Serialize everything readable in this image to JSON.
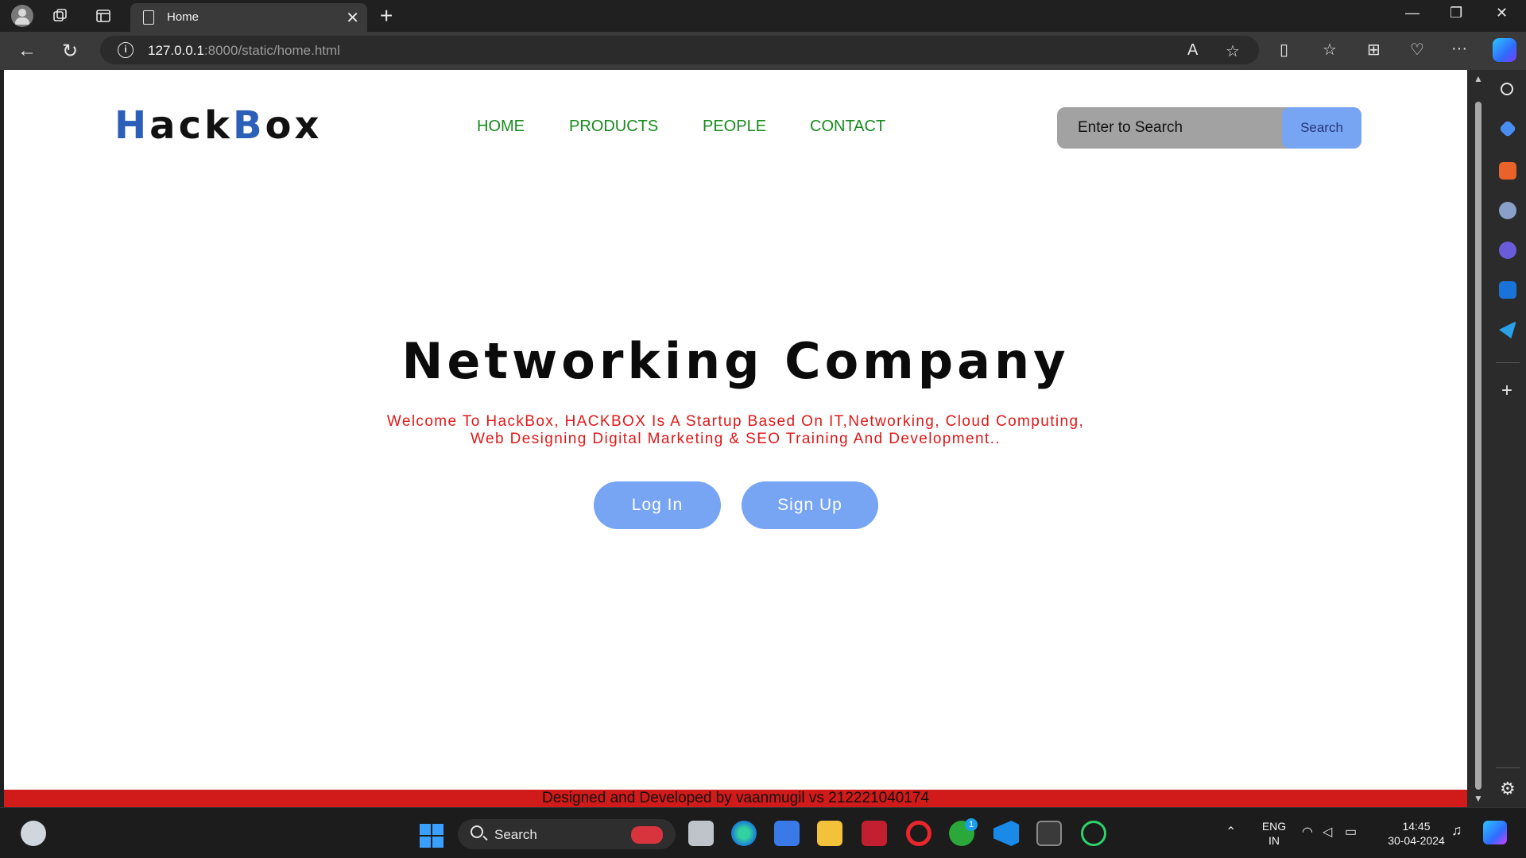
{
  "browser": {
    "tab_title": "Home",
    "tab_close_glyph": "✕",
    "new_tab_glyph": "+",
    "url_host": "127.0.0.1",
    "url_path": ":8000/static/home.html",
    "win_controls": {
      "minimize": "—",
      "restore": "❐",
      "close": "✕"
    },
    "icons": {
      "back": "←",
      "reload": "↻",
      "info": "i",
      "read_aloud": "A",
      "favorite": "☆",
      "split": "▯",
      "favorites": "☆",
      "collections": "⊞",
      "health": "♡",
      "more": "···"
    }
  },
  "page": {
    "brand": {
      "part1": "H",
      "part2": "ack",
      "part3": "B",
      "part4": "ox"
    },
    "nav": [
      "HOME",
      "PRODUCTS",
      "PEOPLE",
      "CONTACT"
    ],
    "search": {
      "placeholder": "Enter to Search",
      "button": "Search"
    },
    "hero": {
      "title": "Networking Company",
      "subtitle_line1": "Welcome To HackBox, HACKBOX Is A Startup Based On IT,Networking, Cloud Computing,",
      "subtitle_line2": "Web Designing Digital Marketing & SEO Training And Development.."
    },
    "buttons": {
      "login": "Log In",
      "signup": "Sign Up"
    },
    "footer": "Designed and Developed by vaanmugil vs 212221040174"
  },
  "taskbar": {
    "search": "Search",
    "lang_top": "ENG",
    "lang_bottom": "IN",
    "time": "14:45",
    "date": "30-04-2024",
    "xbox_badge": "1"
  },
  "colors": {
    "brand_accent": "#2b5fb8",
    "nav_link": "#188a1e",
    "subtitle": "#e01818",
    "button": "#77a5f4",
    "footer": "#d11a1a"
  }
}
